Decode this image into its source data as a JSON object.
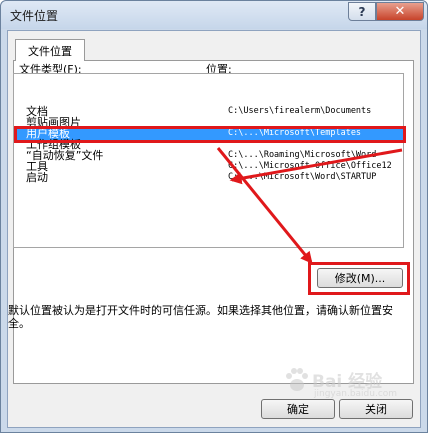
{
  "window": {
    "title": "文件位置",
    "help": "?",
    "close": "✕"
  },
  "tab": {
    "label": "文件位置"
  },
  "columns": {
    "type": "文件类型(F):",
    "location": "位置:"
  },
  "rows": [
    {
      "type": "文档",
      "path": "C:\\Users\\firealerm\\Documents",
      "selected": false
    },
    {
      "type": "剪贴画图片",
      "path": "",
      "selected": false
    },
    {
      "type": "用户模板",
      "path": "C:\\...\\Microsoft\\Templates",
      "selected": true
    },
    {
      "type": "工作组模板",
      "path": "",
      "selected": false
    },
    {
      "type": "“自动恢复”文件",
      "path": "C:\\...\\Roaming\\Microsoft\\Word",
      "selected": false
    },
    {
      "type": "工具",
      "path": "C:\\...\\Microsoft Office\\Office12",
      "selected": false
    },
    {
      "type": "启动",
      "path": "C:\\...\\Microsoft\\Word\\STARTUP",
      "selected": false
    }
  ],
  "modify_button": "修改(M)...",
  "note": "默认位置被认为是打开文件时的可信任源。如果选择其他位置，请确认新位置安全。",
  "ok_button": "确定",
  "close_button": "关闭",
  "watermark": {
    "brand": "Bai 经验",
    "sub": "jingyan.baidu.com"
  },
  "colors": {
    "selection": "#3399ff",
    "annotation": "#e0181b"
  }
}
